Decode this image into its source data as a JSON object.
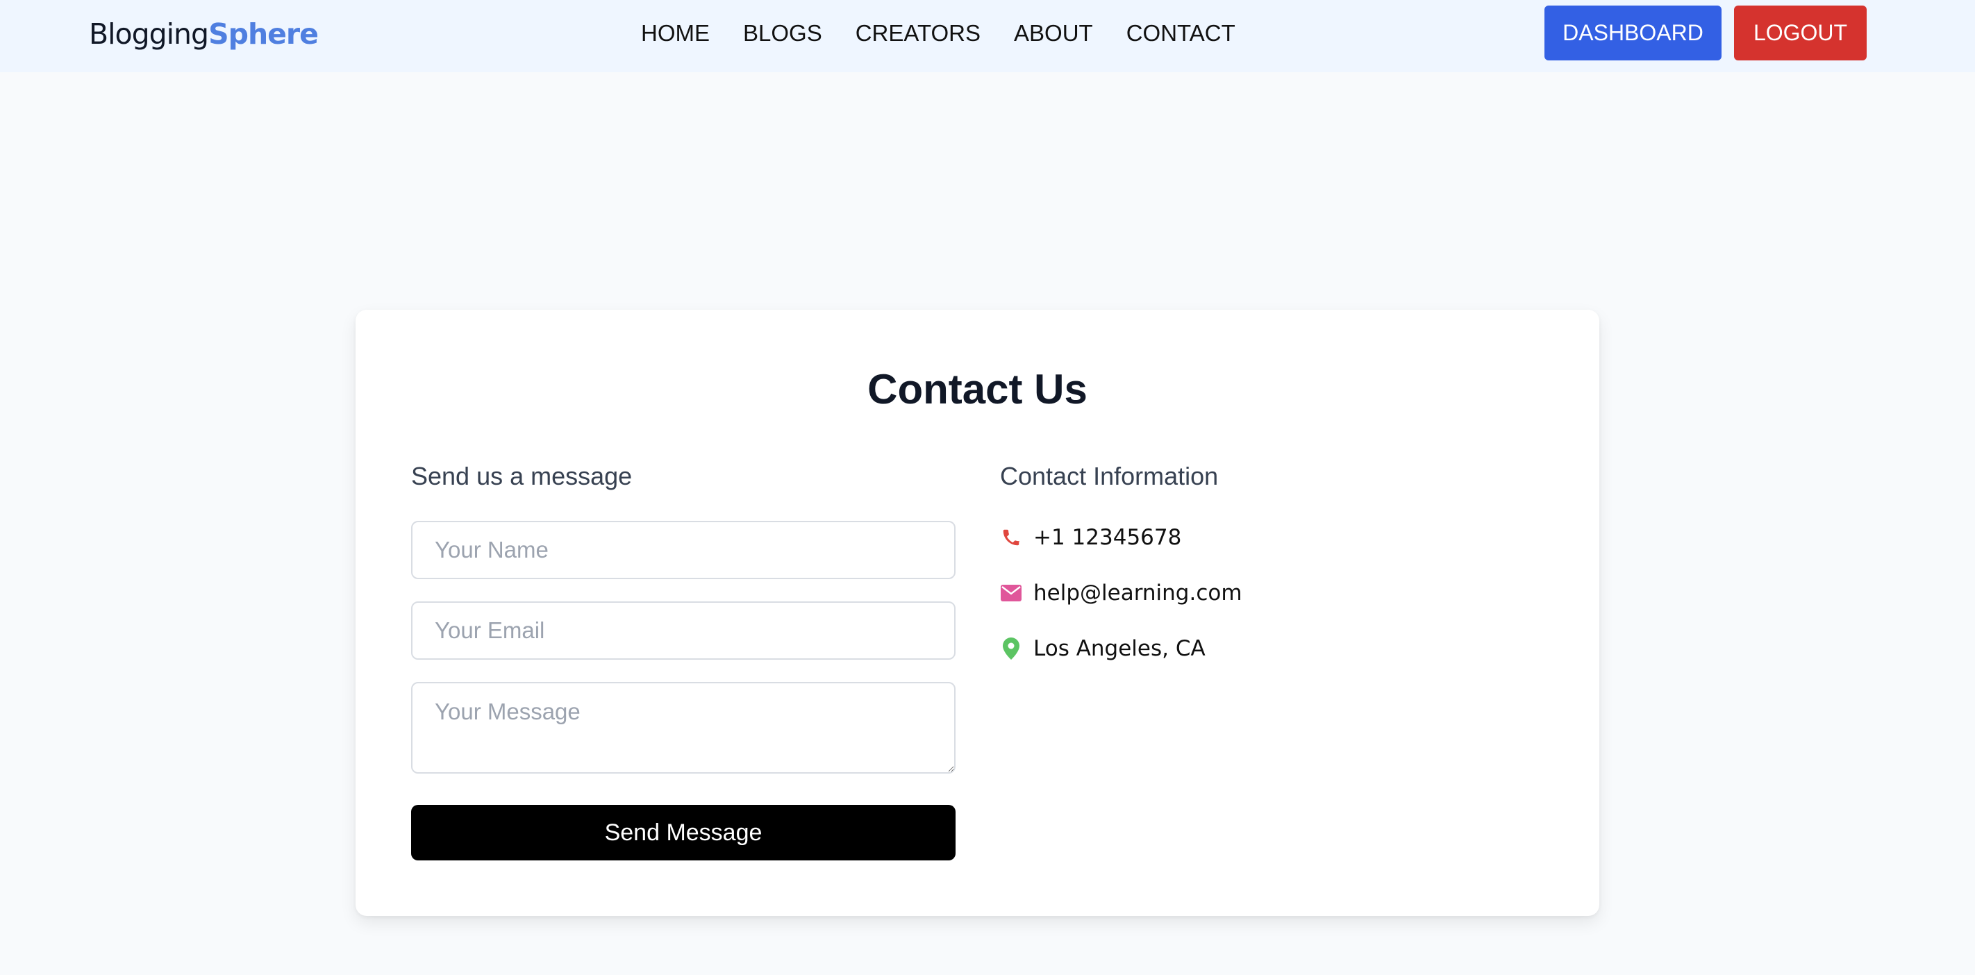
{
  "header": {
    "brand_part1": "Blogging",
    "brand_part2": "Sphere",
    "nav": [
      "HOME",
      "BLOGS",
      "CREATORS",
      "ABOUT",
      "CONTACT"
    ],
    "dashboard_label": "DASHBOARD",
    "logout_label": "LOGOUT"
  },
  "contact": {
    "title": "Contact Us",
    "form": {
      "heading": "Send us a message",
      "name_placeholder": "Your Name",
      "email_placeholder": "Your Email",
      "message_placeholder": "Your Message",
      "submit_label": "Send Message"
    },
    "info": {
      "heading": "Contact Information",
      "phone": "+1 12345678",
      "email": "help@learning.com",
      "location": "Los Angeles, CA"
    }
  },
  "icons": {
    "phone": "phone-icon",
    "email": "envelope-icon",
    "location": "map-pin-icon"
  },
  "colors": {
    "brand_accent": "#4f7fe0",
    "dashboard": "#3360e4",
    "logout": "#d5332e",
    "phone_icon": "#e0463e",
    "email_icon": "#e0569a",
    "location_icon": "#5cc463",
    "send_button": "#000000"
  }
}
